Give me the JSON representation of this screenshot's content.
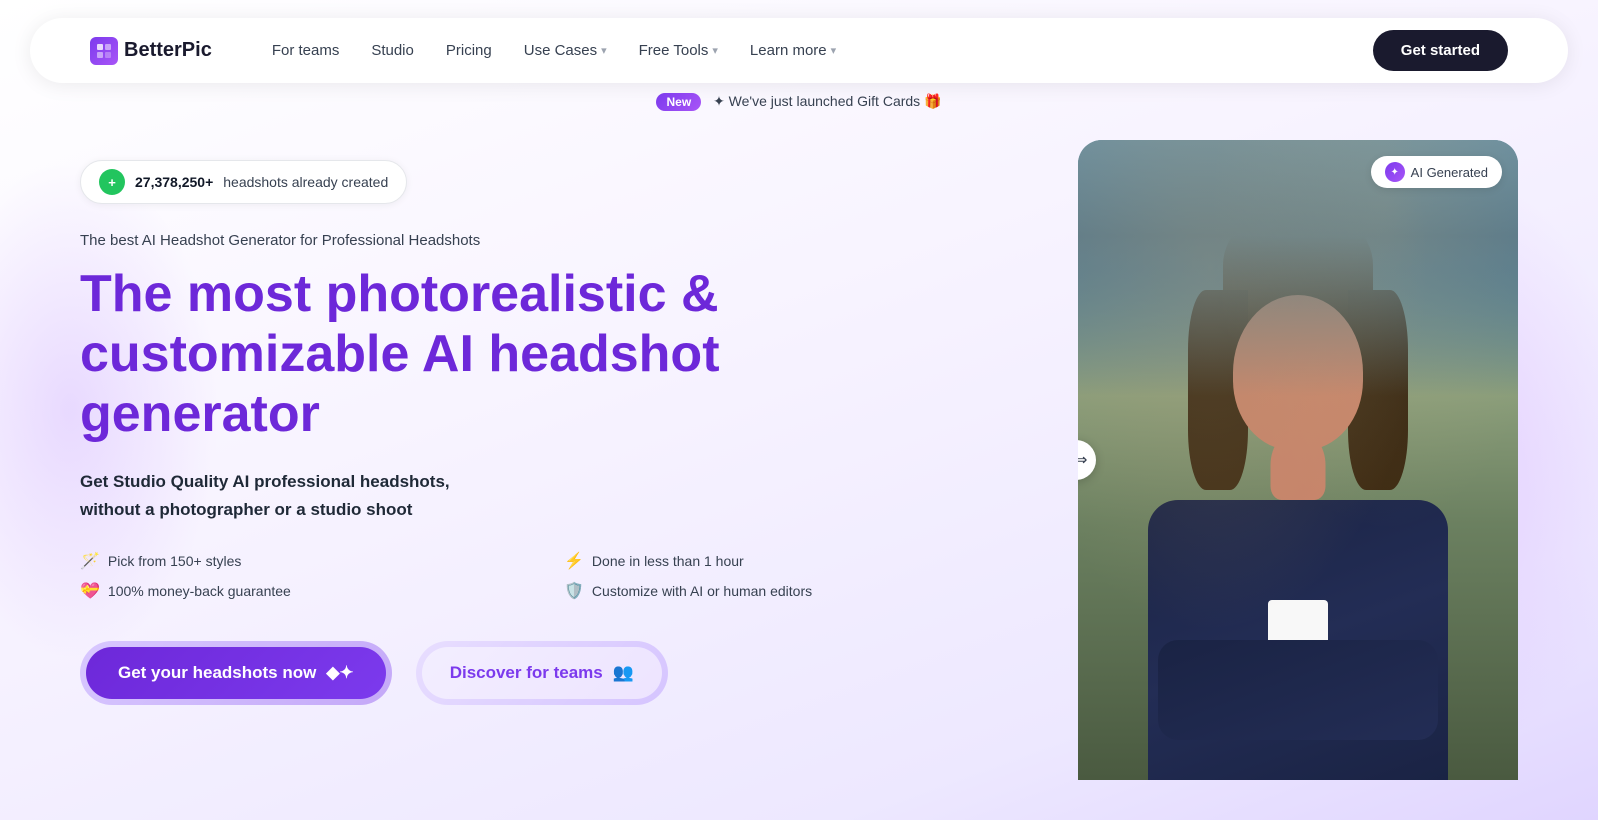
{
  "brand": {
    "name": "BetterPic",
    "logo_char": "B"
  },
  "navbar": {
    "links": [
      {
        "id": "for-teams",
        "label": "For teams",
        "has_dropdown": false
      },
      {
        "id": "studio",
        "label": "Studio",
        "has_dropdown": false
      },
      {
        "id": "pricing",
        "label": "Pricing",
        "has_dropdown": false
      },
      {
        "id": "use-cases",
        "label": "Use Cases",
        "has_dropdown": true
      },
      {
        "id": "free-tools",
        "label": "Free Tools",
        "has_dropdown": true
      },
      {
        "id": "learn-more",
        "label": "Learn more",
        "has_dropdown": true
      }
    ],
    "cta_label": "Get started"
  },
  "announcement": {
    "badge": "New",
    "text": "✦ We've just launched Gift Cards 🎁"
  },
  "hero": {
    "counter_number": "27,378,250+",
    "counter_label": "headshots already created",
    "subtitle": "The best AI Headshot Generator for Professional Headshots",
    "heading_line1": "The most photorealistic &",
    "heading_line2": "customizable AI headshot",
    "heading_line3": "generator",
    "description_line1": "Get Studio Quality AI professional headshots,",
    "description_line2": "without a photographer or a studio shoot",
    "features": [
      {
        "icon": "🪄",
        "text": "Pick from 150+ styles"
      },
      {
        "icon": "⚡",
        "text": "Done in less than 1 hour"
      },
      {
        "icon": "💝",
        "text": "100% money-back guarantee"
      },
      {
        "icon": "🛡️",
        "text": "Customize with AI or human editors"
      }
    ],
    "cta_primary": "Get your headshots now",
    "cta_secondary": "Discover for teams",
    "ai_generated_label": "AI Generated"
  }
}
